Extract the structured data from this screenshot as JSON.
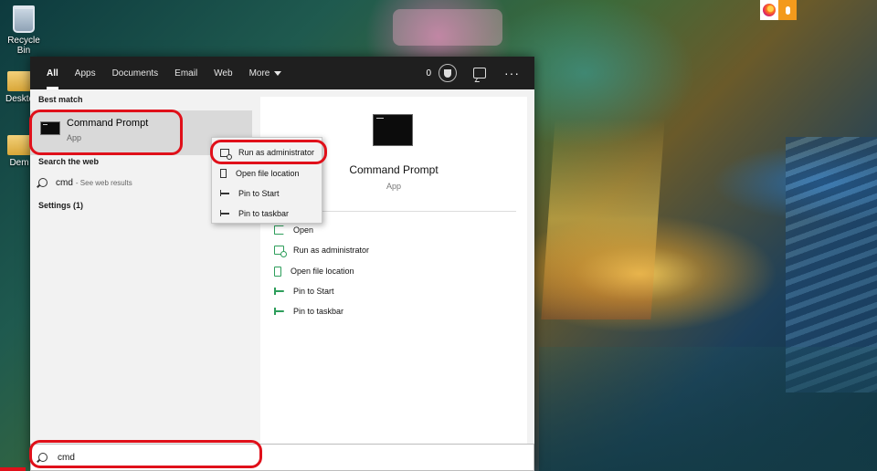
{
  "desktop": {
    "recycle_bin_label": "Recycle Bin",
    "desktop_icon_1_label": "Deskto",
    "desktop_icon_2_label": "Dem"
  },
  "tabs": [
    "All",
    "Apps",
    "Documents",
    "Email",
    "Web",
    "More"
  ],
  "rewards_points": "0",
  "more_dots": "···",
  "left_panel": {
    "best_match_heading": "Best match",
    "best_match": {
      "title": "Command Prompt",
      "subtitle": "App"
    },
    "search_web_heading": "Search the web",
    "web_query": "cmd",
    "web_suffix": "- See web results",
    "settings_heading": "Settings (1)"
  },
  "right_panel": {
    "title": "Command Prompt",
    "subtitle": "App",
    "actions": [
      "Open",
      "Run as administrator",
      "Open file location",
      "Pin to Start",
      "Pin to taskbar"
    ]
  },
  "context_menu": {
    "items": [
      "Run as administrator",
      "Open file location",
      "Pin to Start",
      "Pin to taskbar"
    ]
  },
  "search": {
    "value": "cmd"
  },
  "colors": {
    "highlight": "#e0101a",
    "action_icon": "#2e9e5b",
    "topbar": "#1f1f1f"
  }
}
